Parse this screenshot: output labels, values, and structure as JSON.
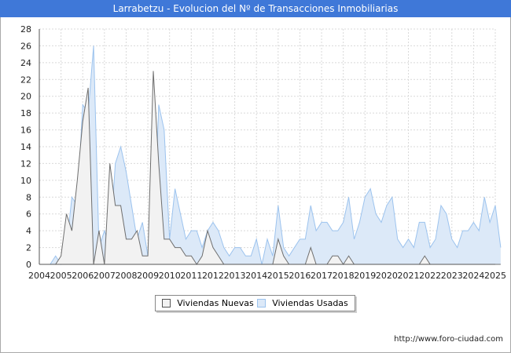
{
  "title": "Larrabetzu - Evolucion del Nº de Transacciones Inmobiliarias",
  "footer_url": "http://www.foro-ciudad.com",
  "colors": {
    "title_bg": "#3f78d8",
    "nuevas_fill": "#f2f2f2",
    "nuevas_line": "#6e6e6e",
    "usadas_fill": "#dce9f8",
    "usadas_line": "#9cc3ee",
    "grid": "#d9d9d9"
  },
  "chart_data": {
    "type": "area",
    "title": "Larrabetzu - Evolucion del Nº de Transacciones Inmobiliarias",
    "x_start": 2004.0,
    "x_step": 0.25,
    "xlim": [
      2004,
      2025
    ],
    "ylim": [
      0,
      28
    ],
    "x_ticks": [
      "2004",
      "2005",
      "2006",
      "2007",
      "2008",
      "2009",
      "2010",
      "2011",
      "2012",
      "2013",
      "2014",
      "2015",
      "2016",
      "2017",
      "2018",
      "2019",
      "2020",
      "2021",
      "2022",
      "2023",
      "2024",
      "2025"
    ],
    "y_ticks": [
      0,
      2,
      4,
      6,
      8,
      10,
      12,
      14,
      16,
      18,
      20,
      22,
      24,
      26,
      28
    ],
    "grid": true,
    "legend_position": "bottom-center",
    "series": [
      {
        "name": "Viviendas Usadas",
        "values": [
          0,
          0,
          0,
          1,
          0,
          2,
          8,
          7,
          19,
          18,
          26,
          2,
          4,
          2,
          12,
          14,
          11,
          7,
          3,
          5,
          1,
          1,
          19,
          16,
          3,
          9,
          6,
          3,
          4,
          4,
          2,
          4,
          5,
          4,
          2,
          1,
          2,
          2,
          1,
          1,
          3,
          0,
          3,
          1,
          7,
          2,
          1,
          2,
          3,
          3,
          7,
          4,
          5,
          5,
          4,
          4,
          5,
          8,
          3,
          5,
          8,
          9,
          6,
          5,
          7,
          8,
          3,
          2,
          3,
          2,
          5,
          5,
          2,
          3,
          7,
          6,
          3,
          2,
          4,
          4,
          5,
          4,
          8,
          5,
          7,
          2
        ]
      },
      {
        "name": "Viviendas Nuevas",
        "values": [
          0,
          0,
          0,
          0,
          1,
          6,
          4,
          10,
          17,
          21,
          0,
          4,
          0,
          12,
          7,
          7,
          3,
          3,
          4,
          1,
          1,
          23,
          12,
          3,
          3,
          2,
          2,
          1,
          1,
          0,
          1,
          4,
          2,
          1,
          0,
          0,
          0,
          0,
          0,
          0,
          0,
          0,
          0,
          0,
          3,
          1,
          0,
          0,
          0,
          0,
          2,
          0,
          0,
          0,
          1,
          1,
          0,
          1,
          0,
          0,
          0,
          0,
          0,
          0,
          0,
          0,
          0,
          0,
          0,
          0,
          0,
          1,
          0,
          0,
          0,
          0,
          0,
          0,
          0,
          0,
          0,
          0,
          0,
          0,
          0,
          0
        ]
      }
    ]
  }
}
